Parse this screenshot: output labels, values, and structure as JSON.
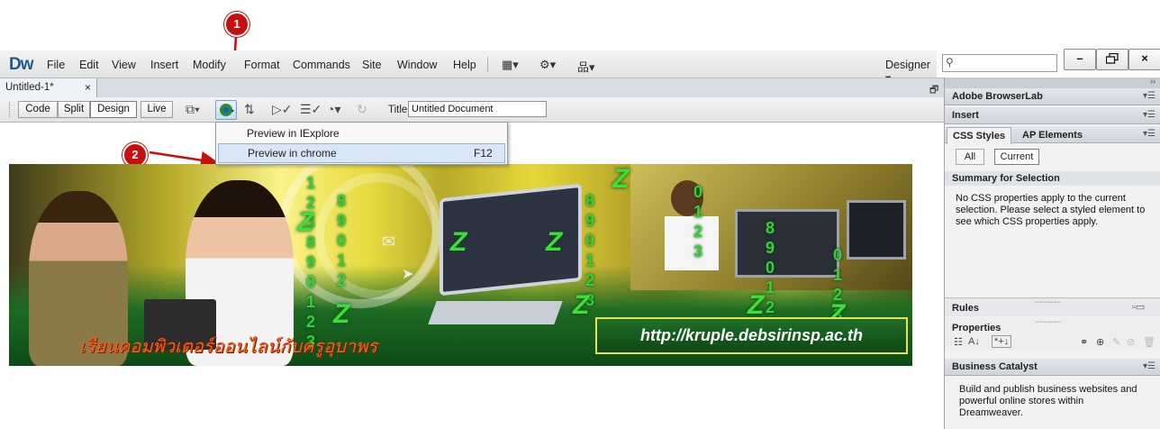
{
  "app": {
    "logo": "Dw",
    "menu": [
      "File",
      "Edit",
      "View",
      "Insert",
      "Modify",
      "Format",
      "Commands",
      "Site",
      "Window",
      "Help"
    ],
    "workspace": "Designer",
    "workspace_arrow": "▾",
    "search_placeholder": "",
    "window_controls": [
      "–",
      "🗗",
      "×"
    ]
  },
  "document_tab": {
    "label": "Untitled-1*",
    "close": "×"
  },
  "doc_toolbar": {
    "view_buttons": [
      "Code",
      "Split",
      "Design",
      "Live"
    ],
    "active_view": "Design",
    "title_label": "Title:",
    "title_value": "Untitled Document"
  },
  "preview_menu": {
    "items": [
      {
        "label": "Preview in IExplore",
        "shortcut": ""
      },
      {
        "label": "Preview in chrome",
        "shortcut": "F12"
      }
    ]
  },
  "banner": {
    "url": "http://kruple.debsirinsp.ac.th",
    "caption": "เรียนคอมพิวเตอร์ออนไลน์กับครูอุบาพร"
  },
  "panels": {
    "adobe_browserlab": "Adobe BrowserLab",
    "insert": "Insert",
    "tabs": [
      "CSS Styles",
      "AP Elements"
    ],
    "mode_buttons": [
      "All",
      "Current"
    ],
    "summary_title": "Summary for Selection",
    "summary_text": "No CSS properties apply to the current selection.  Please select a styled element to see which CSS properties apply.",
    "rules": "Rules",
    "properties": "Properties",
    "business_catalyst": "Business Catalyst",
    "bc_text": "Build and publish business websites and powerful online stores within Dreamweaver."
  },
  "annotations": {
    "badge1": "1",
    "badge2": "2",
    "color": "#c6100e"
  }
}
